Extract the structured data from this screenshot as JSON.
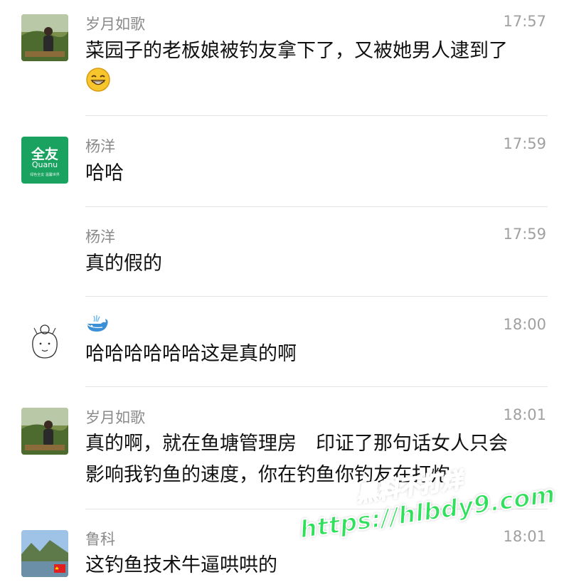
{
  "messages": [
    {
      "name": "岁月如歌",
      "time": "17:57",
      "line1": "菜园子的老板娘被钓友拿下了，又被她男人逮到了",
      "emoji": "grinning-face"
    },
    {
      "name": "杨洋",
      "time": "17:59",
      "text": "哈哈",
      "avatar_brand": "全友",
      "avatar_brand_en": "Quanu",
      "avatar_tagline": "绿色全友 温馨世界"
    },
    {
      "name": "杨洋",
      "time": "17:59",
      "text": "真的假的"
    },
    {
      "name": "whale-emoji",
      "time": "18:00",
      "text": "哈哈哈哈哈哈这是真的啊"
    },
    {
      "name": "岁月如歌",
      "time": "18:01",
      "line1": "真的啊，就在鱼塘管理房　印证了那句话女人只会",
      "line2": "影响我钓鱼的速度，你在钓鱼你钓友在打炮"
    },
    {
      "name": "鲁科",
      "time": "18:01",
      "text": "这钓鱼技术牛逼哄哄的"
    }
  ],
  "watermark": {
    "line1": "黑料不打烊",
    "line2": "https://hlbdy9.com"
  },
  "colors": {
    "brand_green": "#1aa260",
    "watermark_green": "#2fe05a"
  }
}
